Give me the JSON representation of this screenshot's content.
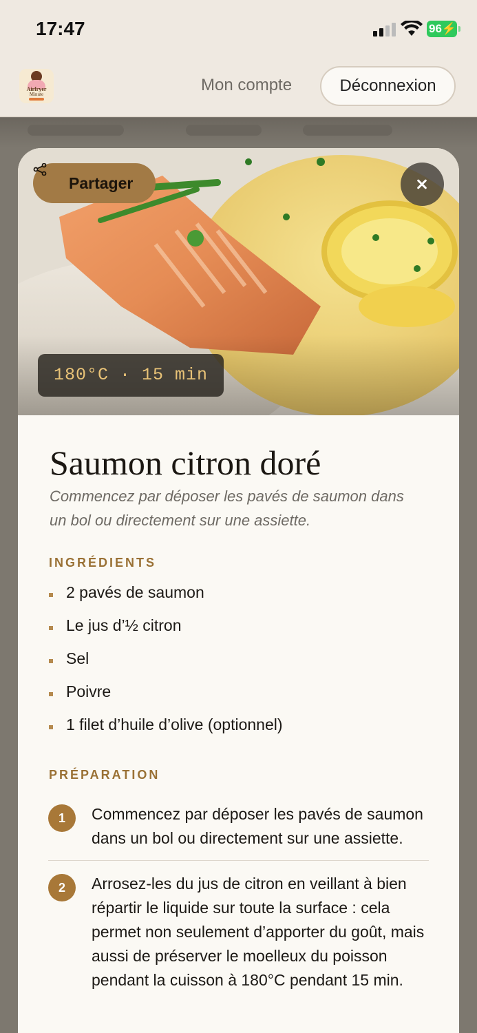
{
  "status_bar": {
    "time": "17:47",
    "battery": "96"
  },
  "header": {
    "logo_text": "Airfryer",
    "logo_subtext": "Minute",
    "account_label": "Mon compte",
    "logout_label": "Déconnexion"
  },
  "recipe": {
    "share_label": "Partager",
    "temperature_time": "180°C · 15 min",
    "title": "Saumon citron doré",
    "subtitle": "Commencez par déposer les pavés de saumon dans un bol ou directement sur une assiette.",
    "ingredients_label": "INGRÉDIENTS",
    "ingredients": [
      "2 pavés de saumon",
      "Le jus d’½ citron",
      "Sel",
      "Poivre",
      "1 filet d’huile d’olive (optionnel)"
    ],
    "preparation_label": "PRÉPARATION",
    "steps": [
      {
        "num": "1",
        "text": "Commencez par déposer les pavés de saumon dans un bol ou directement sur une assiette."
      },
      {
        "num": "2",
        "text": "Arrosez-les du jus de citron en veillant à bien répartir le liquide sur toute la surface : cela permet non seulement d’apporter du goût, mais aussi de préserver le moelleux du poisson pendant la cuisson à 180°C pendant 15 min."
      }
    ]
  }
}
